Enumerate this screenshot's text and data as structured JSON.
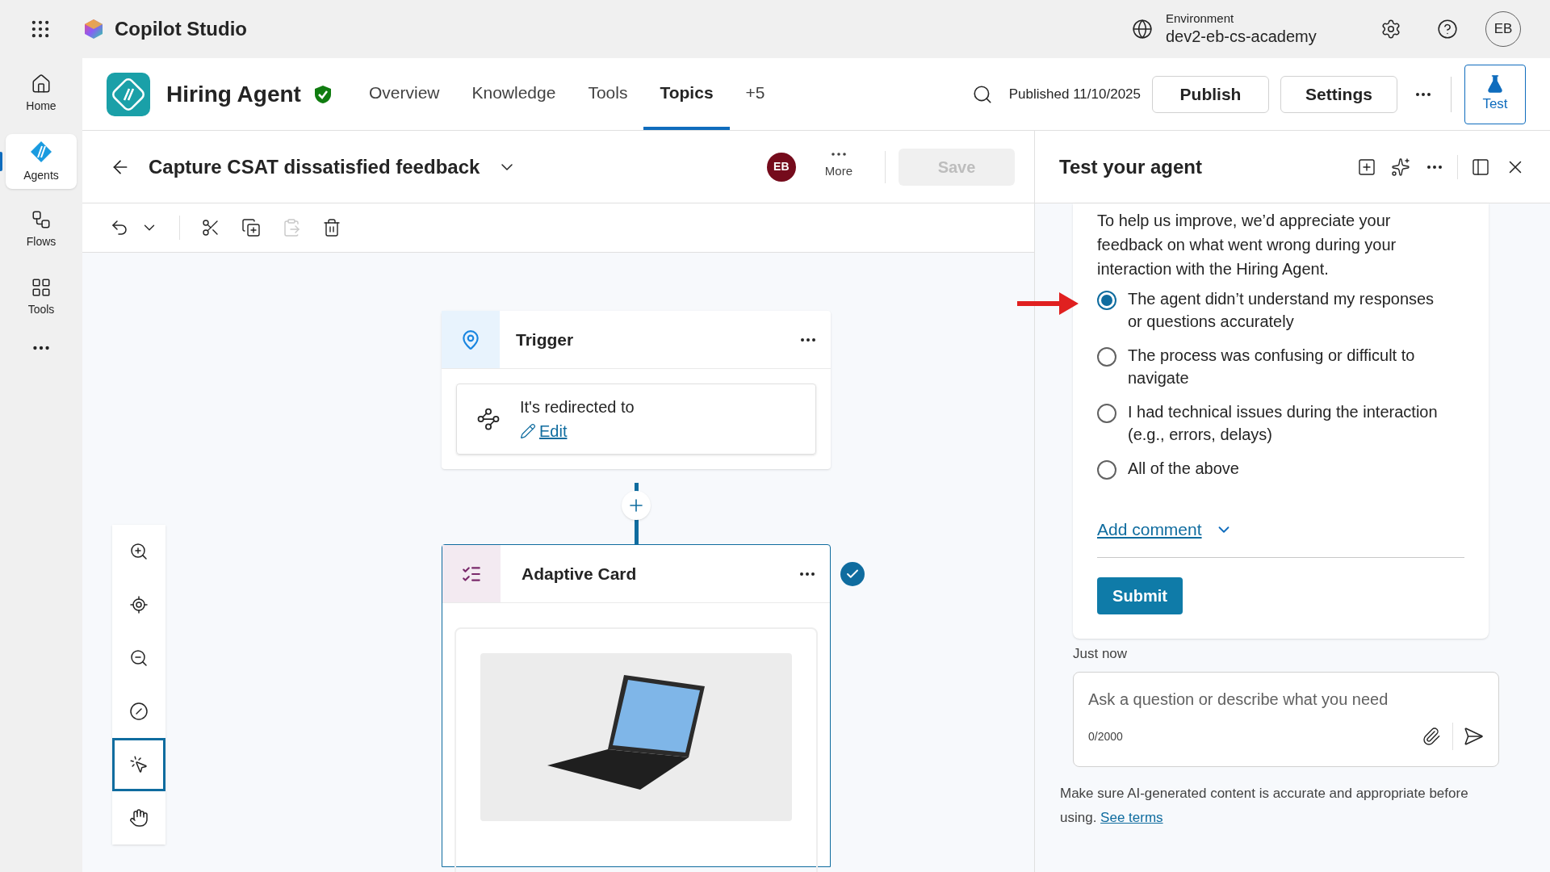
{
  "app": {
    "name": "Copilot Studio"
  },
  "environment": {
    "label": "Environment",
    "value": "dev2-eb-cs-academy"
  },
  "user": {
    "initials": "EB"
  },
  "rail": [
    {
      "kind": "home",
      "label": "Home",
      "selected": false
    },
    {
      "kind": "agents",
      "label": "Agents",
      "selected": true
    },
    {
      "kind": "flows",
      "label": "Flows",
      "selected": false
    },
    {
      "kind": "tools",
      "label": "Tools",
      "selected": false
    }
  ],
  "agent": {
    "name": "Hiring Agent",
    "nav": [
      {
        "label": "Overview",
        "selected": false
      },
      {
        "label": "Knowledge",
        "selected": false
      },
      {
        "label": "Tools",
        "selected": false
      },
      {
        "label": "Topics",
        "selected": true
      },
      {
        "label": "+5",
        "selected": false
      }
    ],
    "published": "Published 11/10/2025",
    "buttons": [
      "Publish",
      "Settings"
    ],
    "test": "Test"
  },
  "topic": {
    "title": "Capture CSAT dissatisfied feedback",
    "editor_initials": "EB",
    "more": "More",
    "save": {
      "label": "Save",
      "disabled": true
    }
  },
  "canvas": {
    "trigger": {
      "title": "Trigger",
      "condition": "It's redirected to",
      "edit": "Edit"
    },
    "card": {
      "title": "Adaptive Card",
      "done": true
    },
    "tools": [
      {
        "kind": "zoom-in",
        "selected": false
      },
      {
        "kind": "center",
        "selected": false
      },
      {
        "kind": "zoom-out",
        "selected": false
      },
      {
        "kind": "minimap",
        "selected": false
      },
      {
        "kind": "select",
        "selected": true
      },
      {
        "kind": "pan",
        "selected": false
      }
    ]
  },
  "test_panel": {
    "title": "Test your agent",
    "intro": "To help us improve, we’d appreciate your feedback on what went wrong during your interaction with the Hiring Agent.",
    "options": [
      {
        "label": "The agent didn’t understand my responses or questions accurately",
        "selected": true
      },
      {
        "label": "The process was confusing or difficult to navigate",
        "selected": false
      },
      {
        "label": "I had technical issues during the interaction (e.g., errors, delays)",
        "selected": false
      },
      {
        "label": "All of the above",
        "selected": false
      }
    ],
    "add_comment": "Add comment",
    "submit": "Submit",
    "timestamp": "Just now",
    "input": {
      "placeholder": "Ask a question or describe what you need",
      "count": "0/2000"
    },
    "disclaimer": "Make sure AI-generated content is accurate and appropriate before using.",
    "terms": "See terms"
  }
}
